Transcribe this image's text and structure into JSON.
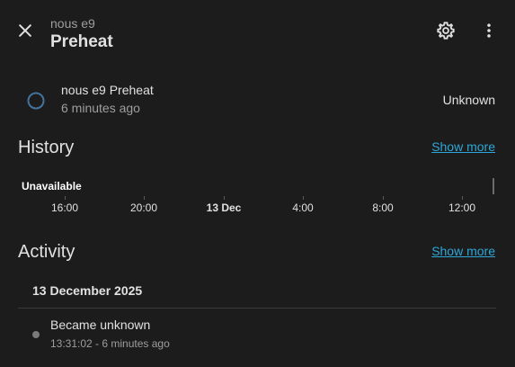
{
  "header": {
    "subtitle": "nous e9",
    "title": "Preheat",
    "close_icon": "close-icon",
    "settings_icon": "gear-icon",
    "menu_icon": "more-vertical-icon"
  },
  "entity": {
    "name": "nous e9 Preheat",
    "last_changed": "6 minutes ago",
    "state": "Unknown",
    "icon": "circle-outline-icon",
    "icon_color": "#44739e"
  },
  "history": {
    "title": "History",
    "show_more": "Show more",
    "timeline_label": "Unavailable",
    "ticks": [
      "16:00",
      "20:00",
      "13 Dec",
      "4:00",
      "8:00",
      "12:00"
    ]
  },
  "activity": {
    "title": "Activity",
    "show_more": "Show more",
    "date": "13 December 2025",
    "entries": [
      {
        "message": "Became unknown",
        "time": "13:31:02 - 6 minutes ago"
      }
    ]
  },
  "colors": {
    "background": "#1c1c1c",
    "link": "#2ea7d8",
    "text_primary": "#e1e1e1",
    "text_secondary": "#9e9e9e"
  }
}
